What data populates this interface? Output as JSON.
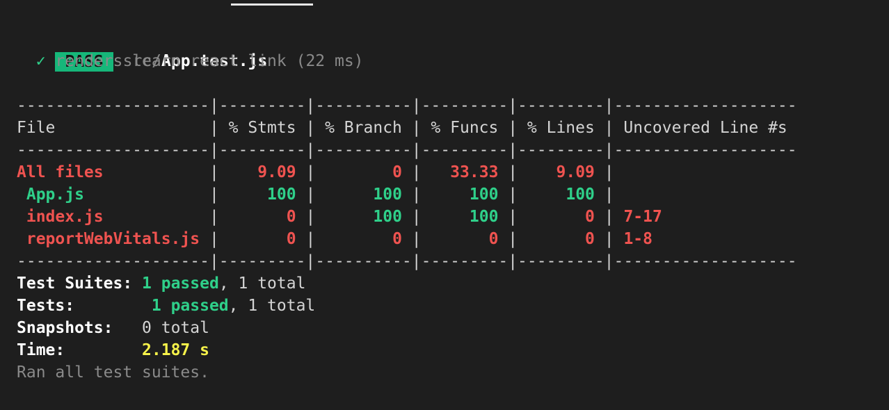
{
  "header": {
    "badge": "PASS",
    "path_prefix": "src/",
    "file_name": "App.test.js",
    "test_check": "✓",
    "test_name": "renders learn react link (22 ms)"
  },
  "coverage": {
    "separator": "--------------------|---------|----------|---------|---------|-------------------",
    "header_row": "File                | % Stmts | % Branch | % Funcs | % Lines | Uncovered Line #s ",
    "rows": [
      {
        "file": "All files",
        "stmts": "9.09",
        "branch": "0",
        "funcs": "33.33",
        "lines": "9.09",
        "uncovered": "",
        "status": "red"
      },
      {
        "file": " App.js",
        "stmts": "100",
        "branch": "100",
        "funcs": "100",
        "lines": "100",
        "uncovered": "",
        "status": "green"
      },
      {
        "file": " index.js",
        "stmts": "0",
        "branch": "100",
        "funcs": "100",
        "lines": "0",
        "uncovered": "7-17",
        "status": "mixed"
      },
      {
        "file": " reportWebVitals.js",
        "stmts": "0",
        "branch": "0",
        "funcs": "0",
        "lines": "0",
        "uncovered": "1-8",
        "status": "red"
      }
    ]
  },
  "summary": {
    "suites_label": "Test Suites:",
    "suites_passed": "1 passed",
    "suites_total": ", 1 total",
    "tests_label": "Tests:",
    "tests_passed": "1 passed",
    "tests_total": ", 1 total",
    "snapshots_label": "Snapshots:",
    "snapshots_value": "0 total",
    "time_label": "Time:",
    "time_value": "2.187 s",
    "footer": "Ran all test suites."
  },
  "colors": {
    "background": "#1e1e1e",
    "pass_badge": "#16b77a",
    "green": "#2fd08a",
    "red": "#ef5350",
    "yellow": "#f6f24a",
    "dim": "#8a8a8a"
  }
}
